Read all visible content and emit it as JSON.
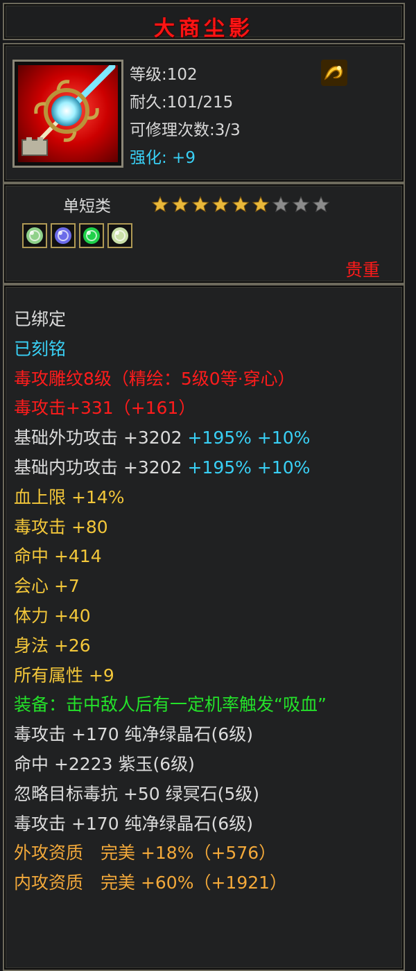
{
  "item": {
    "name": "大商尘影",
    "level": "等级:102",
    "durability": "耐久:101/215",
    "repairs": "可修理次数:3/3",
    "enhance": "强化: +9",
    "category": "单短类",
    "stars_filled": 6,
    "stars_total": 9,
    "quality": "贵重"
  },
  "gems": [
    {
      "icon": "white-jade-gem-icon",
      "color": "#8fd18a"
    },
    {
      "icon": "purple-jade-gem-icon",
      "color": "#6b6be8"
    },
    {
      "icon": "green-crystal-gem-icon",
      "color": "#1fd04a"
    },
    {
      "icon": "white-jade-gem-icon",
      "color": "#c9e0a8"
    }
  ],
  "attributes": [
    {
      "segments": [
        {
          "text": "已绑定",
          "color": "white"
        }
      ]
    },
    {
      "segments": [
        {
          "text": "已刻铭",
          "color": "cyan"
        }
      ]
    },
    {
      "segments": [
        {
          "text": "毒攻雕纹8级（精绘：5级0等·穿心）",
          "color": "red"
        }
      ]
    },
    {
      "segments": [
        {
          "text": "毒攻击+331（+161）",
          "color": "red"
        }
      ]
    },
    {
      "segments": [
        {
          "text": "基础外功攻击 +3202 ",
          "color": "white"
        },
        {
          "text": "+195% +10%",
          "color": "cyan"
        }
      ]
    },
    {
      "segments": [
        {
          "text": "基础内功攻击 +3202 ",
          "color": "white"
        },
        {
          "text": "+195% +10%",
          "color": "cyan"
        }
      ]
    },
    {
      "segments": [
        {
          "text": "血上限 +14%",
          "color": "yellow"
        }
      ]
    },
    {
      "segments": [
        {
          "text": "毒攻击 +80",
          "color": "yellow"
        }
      ]
    },
    {
      "segments": [
        {
          "text": "命中 +414",
          "color": "yellow"
        }
      ]
    },
    {
      "segments": [
        {
          "text": "会心 +7",
          "color": "yellow"
        }
      ]
    },
    {
      "segments": [
        {
          "text": "体力 +40",
          "color": "yellow"
        }
      ]
    },
    {
      "segments": [
        {
          "text": "身法 +26",
          "color": "yellow"
        }
      ]
    },
    {
      "segments": [
        {
          "text": "所有属性 +9",
          "color": "yellow"
        }
      ]
    },
    {
      "segments": [
        {
          "text": "装备：击中敌人后有一定机率触发“吸血”",
          "color": "green"
        }
      ],
      "wrap": true
    },
    {
      "segments": [
        {
          "text": "毒攻击 +170 纯净绿晶石(6级)",
          "color": "white"
        }
      ]
    },
    {
      "segments": [
        {
          "text": "命中 +2223 紫玉(6级)",
          "color": "white"
        }
      ]
    },
    {
      "segments": [
        {
          "text": "忽略目标毒抗 +50 绿冥石(5级)",
          "color": "white"
        }
      ]
    },
    {
      "segments": [
        {
          "text": "毒攻击 +170 纯净绿晶石(6级)",
          "color": "white"
        }
      ]
    },
    {
      "segments": [
        {
          "text": "外攻资质　完美 +18%（+576）",
          "color": "orange"
        }
      ]
    },
    {
      "segments": [
        {
          "text": "内攻资质　完美 +60%（+1921）",
          "color": "orange"
        }
      ]
    }
  ]
}
